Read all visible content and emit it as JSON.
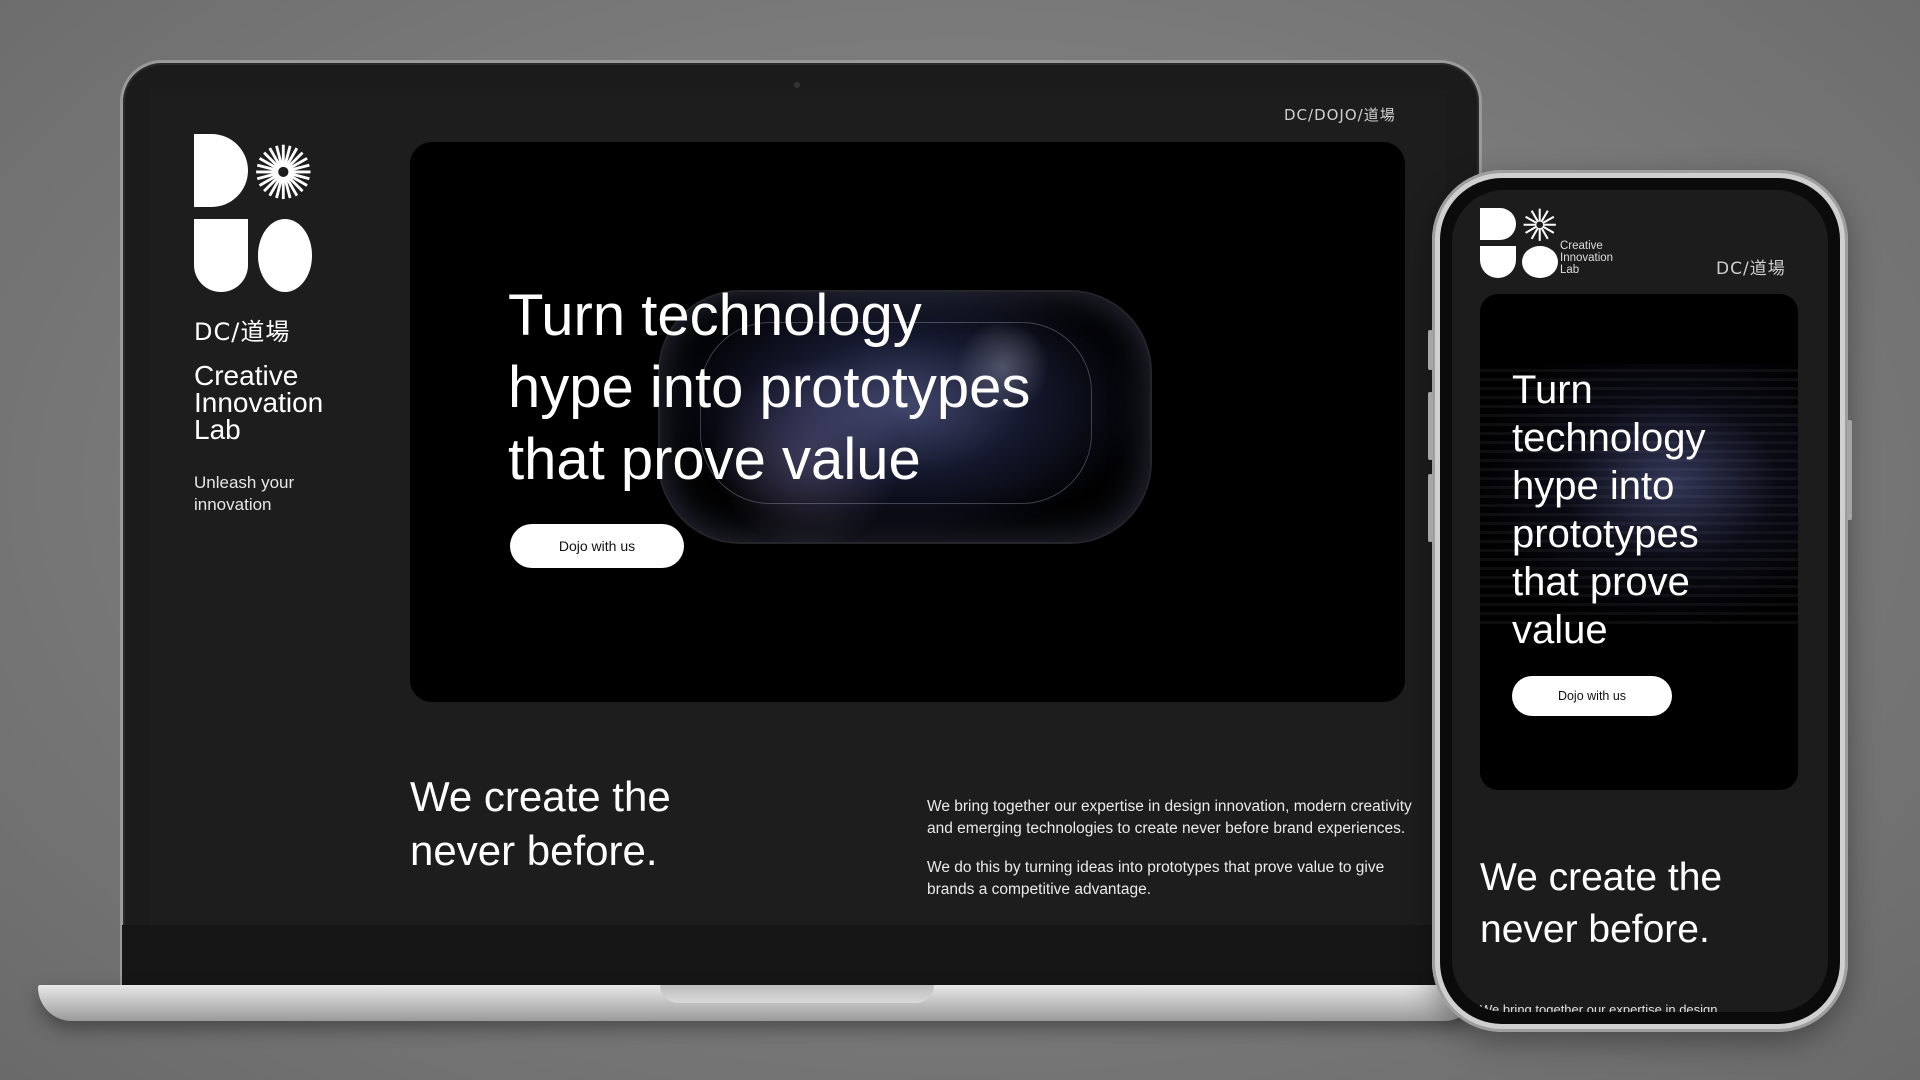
{
  "colors": {
    "page_background": "#7a7a7a",
    "site_background": "#1d1d1d",
    "hero_background": "#000000",
    "button_background": "#ffffff",
    "button_text": "#111111",
    "text": "#ffffff"
  },
  "brand": {
    "mark": "DC/DOJO/道場",
    "short_mark": "DC/道場",
    "lab_lines": [
      "Creative",
      "Innovation",
      "Lab"
    ],
    "tagline_lines": [
      "Unleash your",
      "innovation"
    ]
  },
  "hero": {
    "headline_lines": [
      "Turn technology",
      "hype into prototypes",
      "that prove value"
    ],
    "cta_label": "Dojo with us"
  },
  "section": {
    "title_lines": [
      "We create the",
      "never before."
    ],
    "paragraphs": [
      "We bring together our expertise in design innovation, modern creativity and emerging technologies to create never before brand experiences.",
      "We do this by turning ideas into prototypes that prove value to give brands a competitive advantage."
    ]
  },
  "mobile": {
    "lab_lines": [
      "Creative",
      "Innovation",
      "Lab"
    ],
    "top_mark": "DC/道場",
    "headline_lines": [
      "Turn",
      "technology",
      "hype into",
      "prototypes",
      "that prove",
      "value"
    ],
    "cta_label": "Dojo with us",
    "section_title_lines": [
      "We create the",
      "never before."
    ],
    "section_copy_partial": "We bring together our expertise in design"
  }
}
